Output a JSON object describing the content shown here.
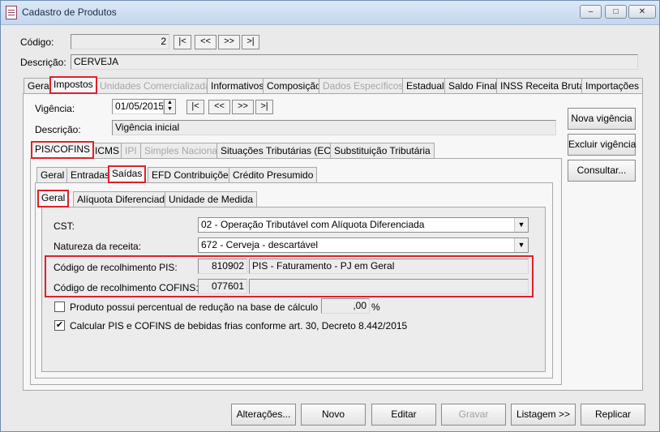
{
  "window": {
    "title": "Cadastro de Produtos",
    "controls": [
      "minimize-icon",
      "maximize-icon",
      "close-icon"
    ]
  },
  "header": {
    "codigo_label": "Código:",
    "codigo_value": "2",
    "nav": [
      "|<",
      "<<",
      ">>",
      ">|"
    ],
    "descricao_label": "Descrição:",
    "descricao_value": "CERVEJA"
  },
  "main_tabs": [
    {
      "label": "Geral",
      "state": "normal"
    },
    {
      "label": "Impostos",
      "state": "active"
    },
    {
      "label": "Unidades Comercializadas",
      "state": "disabled"
    },
    {
      "label": "Informativos",
      "state": "normal"
    },
    {
      "label": "Composição",
      "state": "normal"
    },
    {
      "label": "Dados Específicos",
      "state": "disabled"
    },
    {
      "label": "Estadual",
      "state": "normal"
    },
    {
      "label": "Saldo Final",
      "state": "normal"
    },
    {
      "label": "INSS Receita Bruta",
      "state": "normal"
    },
    {
      "label": "Importações",
      "state": "normal"
    }
  ],
  "vigencia": {
    "label": "Vigência:",
    "value": "01/05/2015",
    "nav": [
      "|<",
      "<<",
      ">>",
      ">|"
    ],
    "descricao_label": "Descrição:",
    "descricao_value": "Vigência inicial",
    "buttons": [
      "Nova vigência",
      "Excluir vigência",
      "Consultar..."
    ]
  },
  "tax_tabs": [
    {
      "label": "PIS/COFINS",
      "state": "active"
    },
    {
      "label": "ICMS",
      "state": "normal"
    },
    {
      "label": "IPI",
      "state": "disabled"
    },
    {
      "label": "Simples Nacional",
      "state": "disabled"
    },
    {
      "label": "Situações Tributárias (ECF)",
      "state": "normal"
    },
    {
      "label": "Substituição Tributária",
      "state": "normal"
    }
  ],
  "pis_tabs": [
    {
      "label": "Geral",
      "state": "normal"
    },
    {
      "label": "Entradas",
      "state": "normal"
    },
    {
      "label": "Saídas",
      "state": "active"
    },
    {
      "label": "EFD Contribuições",
      "state": "normal"
    },
    {
      "label": "Crédito Presumido",
      "state": "normal"
    }
  ],
  "saidas_tabs": [
    {
      "label": "Geral",
      "state": "active"
    },
    {
      "label": "Alíquota Diferenciada",
      "state": "normal"
    },
    {
      "label": "Unidade de Medida",
      "state": "normal"
    }
  ],
  "form": {
    "cst_label": "CST:",
    "cst_value": "02 - Operação Tributável com Alíquota Diferenciada",
    "natureza_label": "Natureza da receita:",
    "natureza_value": "672 - Cerveja - descartável",
    "pis_label": "Código de recolhimento PIS:",
    "pis_code": "810902",
    "pis_desc": "PIS - Faturamento - PJ em Geral",
    "cofins_label": "Código de recolhimento COFINS:",
    "cofins_code": "077601",
    "cofins_desc": "",
    "reducao_label": "Produto possui percentual de redução na base de cálculo de:",
    "reducao_checked": false,
    "reducao_value": ",00",
    "reducao_unit": "%",
    "bebidas_label": "Calcular PIS e COFINS de bebidas frias conforme art. 30, Decreto 8.442/2015",
    "bebidas_checked": true
  },
  "footer_buttons": [
    {
      "label": "Alterações...",
      "state": "normal"
    },
    {
      "label": "Novo",
      "state": "normal"
    },
    {
      "label": "Editar",
      "state": "normal"
    },
    {
      "label": "Gravar",
      "state": "disabled"
    },
    {
      "label": "Listagem >>",
      "state": "normal"
    },
    {
      "label": "Replicar",
      "state": "normal"
    }
  ],
  "colors": {
    "highlight": "#e0202a",
    "window_bg": "#eaeaea",
    "titlebar": "#c4d6ee",
    "disabled_text": "#a0a0a0"
  }
}
